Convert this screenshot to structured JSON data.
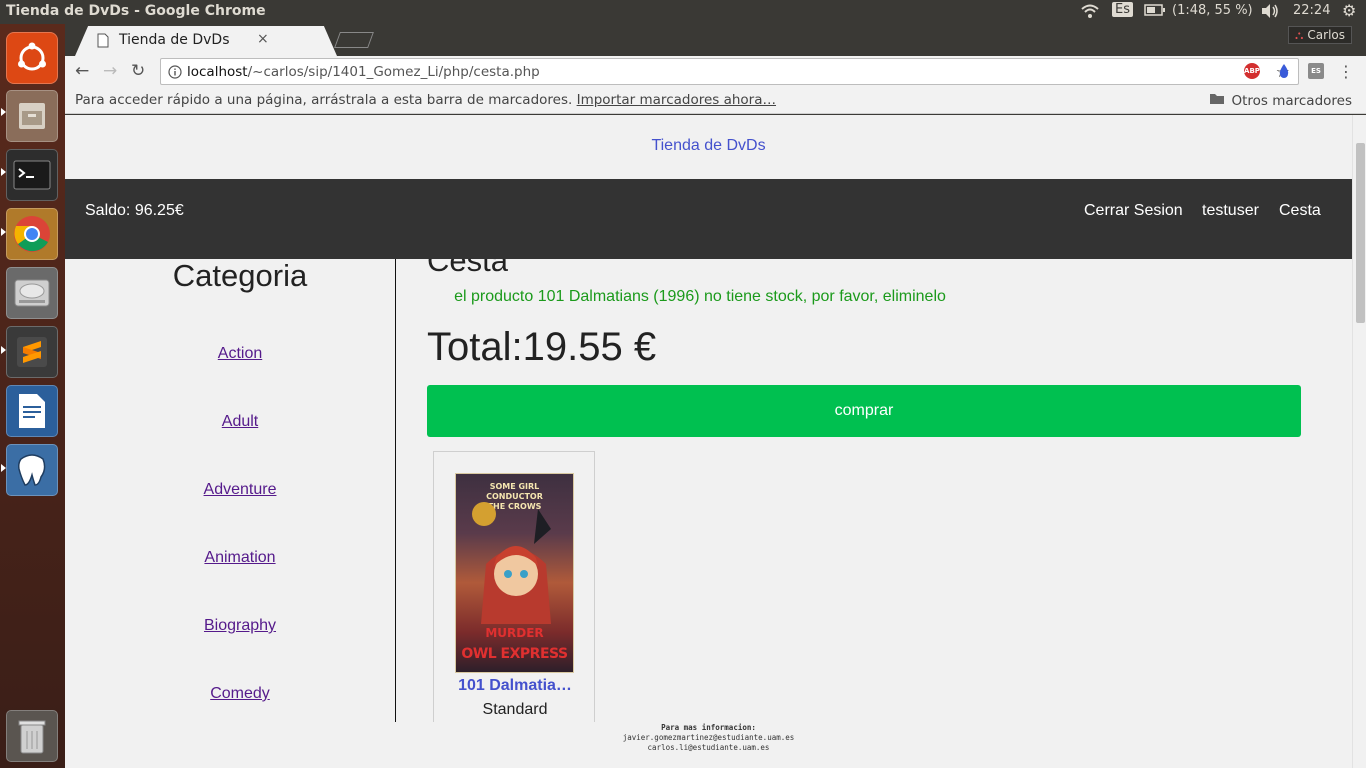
{
  "os": {
    "window_title": "Tienda de DvDs - Google Chrome",
    "keyboard_layout": "Es",
    "battery": "(1:48, 55 %)",
    "clock": "22:24"
  },
  "launcher": {
    "items": [
      "ubuntu-dash-icon",
      "files-icon",
      "terminal-icon",
      "chrome-icon",
      "disk-icon",
      "sublime-icon",
      "writer-icon",
      "pgadmin-icon",
      "trash-icon"
    ]
  },
  "browser": {
    "tab_title": "Tienda de DvDs",
    "tab_close": "×",
    "user": "Carlos",
    "url_host": "localhost",
    "url_path": "/~carlos/sip/1401_Gomez_Li/php/cesta.php",
    "bookmarks_hint": "Para acceder rápido a una página, arrástrala a esta barra de marcadores.",
    "bookmarks_import": "Importar marcadores ahora…",
    "other_bookmarks": "Otros marcadores",
    "extensions": [
      "ABP",
      "",
      "ES"
    ]
  },
  "page": {
    "site_title": "Tienda de DvDs",
    "navbar": {
      "saldo": "Saldo: 96.25€",
      "logout": "Cerrar Sesion",
      "username": "testuser",
      "cart": "Cesta"
    },
    "sidebar": {
      "title": "Categoria",
      "categories": [
        "Action",
        "Adult",
        "Adventure",
        "Animation",
        "Biography",
        "Comedy"
      ]
    },
    "main": {
      "title": "Cesta",
      "stock_message": "el producto 101 Dalmatians (1996) no tiene stock, por favor, eliminelo",
      "total": "Total:19.55 €",
      "buy_button": "comprar"
    },
    "product": {
      "name": "101 Dalmatia…",
      "format": "Standard",
      "poster_top": "SOME GIRL CONDUCTOR THE CROWS",
      "poster_bottom_1": "MURDER",
      "poster_bottom_2": "OWL EXPRESS"
    },
    "footer": {
      "heading": "Para mas informacion:",
      "email1": "javier.gomezmartinez@estudiante.uam.es",
      "email2": "carlos.li@estudiante.uam.es"
    }
  }
}
